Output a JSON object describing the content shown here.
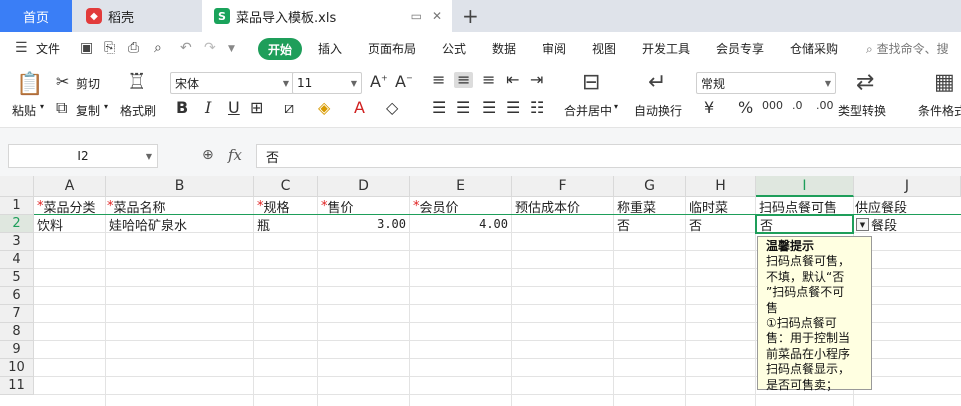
{
  "tabs": {
    "home": "首页",
    "daoke": "稻壳",
    "file": "菜品导入模板.xls",
    "plus": "+"
  },
  "menu": {
    "file": "文件",
    "items": [
      "开始",
      "插入",
      "页面布局",
      "公式",
      "数据",
      "审阅",
      "视图",
      "开发工具",
      "会员专享",
      "仓储采购"
    ],
    "search": "查找命令、搜"
  },
  "ribbon": {
    "paste": "粘贴",
    "cut": "剪切",
    "copy": "复制",
    "format_painter": "格式刷",
    "font_name": "宋体",
    "font_size": "11",
    "bold": "B",
    "italic": "I",
    "underline": "U",
    "merge_center": "合并居中",
    "wrap": "自动换行",
    "number_format": "常规",
    "currency": "¥",
    "percent": "%",
    "type_convert": "类型转换",
    "cond_format": "条件格式"
  },
  "formula_bar": {
    "cell_ref": "I2",
    "fx": "fx",
    "value": "否"
  },
  "columns": [
    "A",
    "B",
    "C",
    "D",
    "E",
    "F",
    "G",
    "H",
    "I",
    "J"
  ],
  "rows": [
    "1",
    "2",
    "3",
    "4",
    "5",
    "6",
    "7",
    "8",
    "9",
    "10",
    "11"
  ],
  "headers": [
    {
      "req": "*",
      "text": "菜品分类"
    },
    {
      "req": "*",
      "text": "菜品名称"
    },
    {
      "req": "*",
      "text": "规格"
    },
    {
      "req": "*",
      "text": "售价"
    },
    {
      "req": "*",
      "text": "会员价"
    },
    {
      "req": "",
      "text": "预估成本价"
    },
    {
      "req": "",
      "text": "称重菜"
    },
    {
      "req": "",
      "text": "临时菜"
    },
    {
      "req": "",
      "text": "扫码点餐可售"
    },
    {
      "req": "",
      "text": "供应餐段"
    }
  ],
  "row2": {
    "a": "饮料",
    "b": "娃哈哈矿泉水",
    "c": "瓶",
    "d": "3.00",
    "e": "4.00",
    "g": "否",
    "h": "否",
    "i": "否",
    "j": "餐段"
  },
  "tooltip": {
    "title": "温馨提示",
    "lines": [
      "扫码点餐可售，",
      "不填，默认“否",
      "”扫码点餐不可",
      "售",
      "①扫码点餐可",
      "售：用于控制当",
      "前菜品在小程序",
      "扫码点餐显示，",
      "是否可售卖；"
    ]
  },
  "colors": {
    "accent": "#1e9e5a",
    "home_tab": "#3a7ef6",
    "required": "#e02020"
  }
}
